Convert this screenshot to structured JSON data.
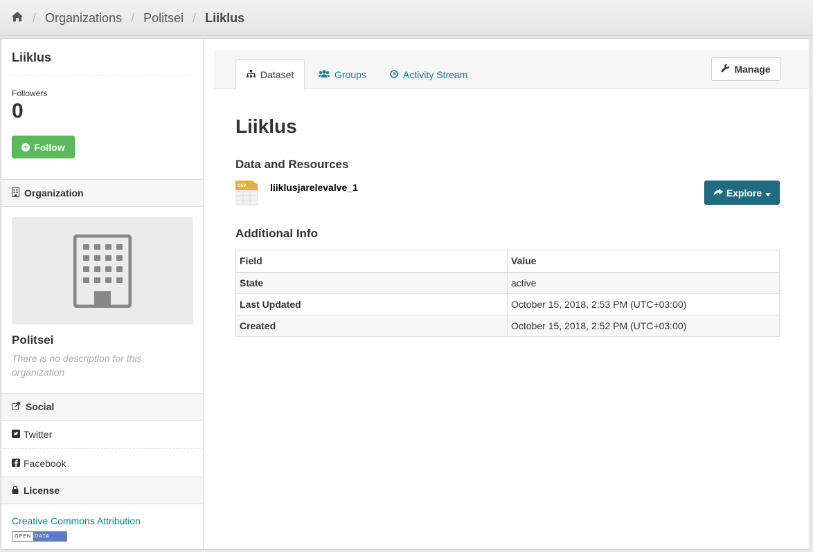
{
  "breadcrumb": {
    "home_icon": "home-icon",
    "items": [
      "Organizations",
      "Politsei"
    ],
    "current": "Liiklus"
  },
  "sidebar": {
    "title": "Liiklus",
    "followers_label": "Followers",
    "followers_count": "0",
    "follow_button": "Follow",
    "organization_heading": "Organization",
    "org_name": "Politsei",
    "org_description": "There is no description for this organization",
    "social_heading": "Social",
    "social_links": [
      {
        "label": "Twitter",
        "icon": "twitter-icon"
      },
      {
        "label": "Facebook",
        "icon": "facebook-icon"
      }
    ],
    "license_heading": "License",
    "license_link": "Creative Commons Attribution",
    "badge_left": "OPEN",
    "badge_right": "DATA"
  },
  "tabs": [
    {
      "label": "Dataset",
      "icon": "sitemap-icon",
      "active": true
    },
    {
      "label": "Groups",
      "icon": "users-icon",
      "active": false
    },
    {
      "label": "Activity Stream",
      "icon": "clock-icon",
      "active": false
    }
  ],
  "manage_button": "Manage",
  "main": {
    "title": "Liiklus",
    "data_heading": "Data and Resources",
    "resource_name": "liiklusjarelevalve_1",
    "resource_format": "CSV",
    "explore_button": "Explore",
    "info_heading": "Additional Info",
    "table": {
      "headers": [
        "Field",
        "Value"
      ],
      "rows": [
        [
          "State",
          "active"
        ],
        [
          "Last Updated",
          "October 15, 2018, 2:53 PM (UTC+03:00)"
        ],
        [
          "Created",
          "October 15, 2018, 2:52 PM (UTC+03:00)"
        ]
      ]
    }
  },
  "colors": {
    "follow_green": "#5cb85c",
    "explore_teal": "#206b82",
    "link_blue": "#187794"
  }
}
